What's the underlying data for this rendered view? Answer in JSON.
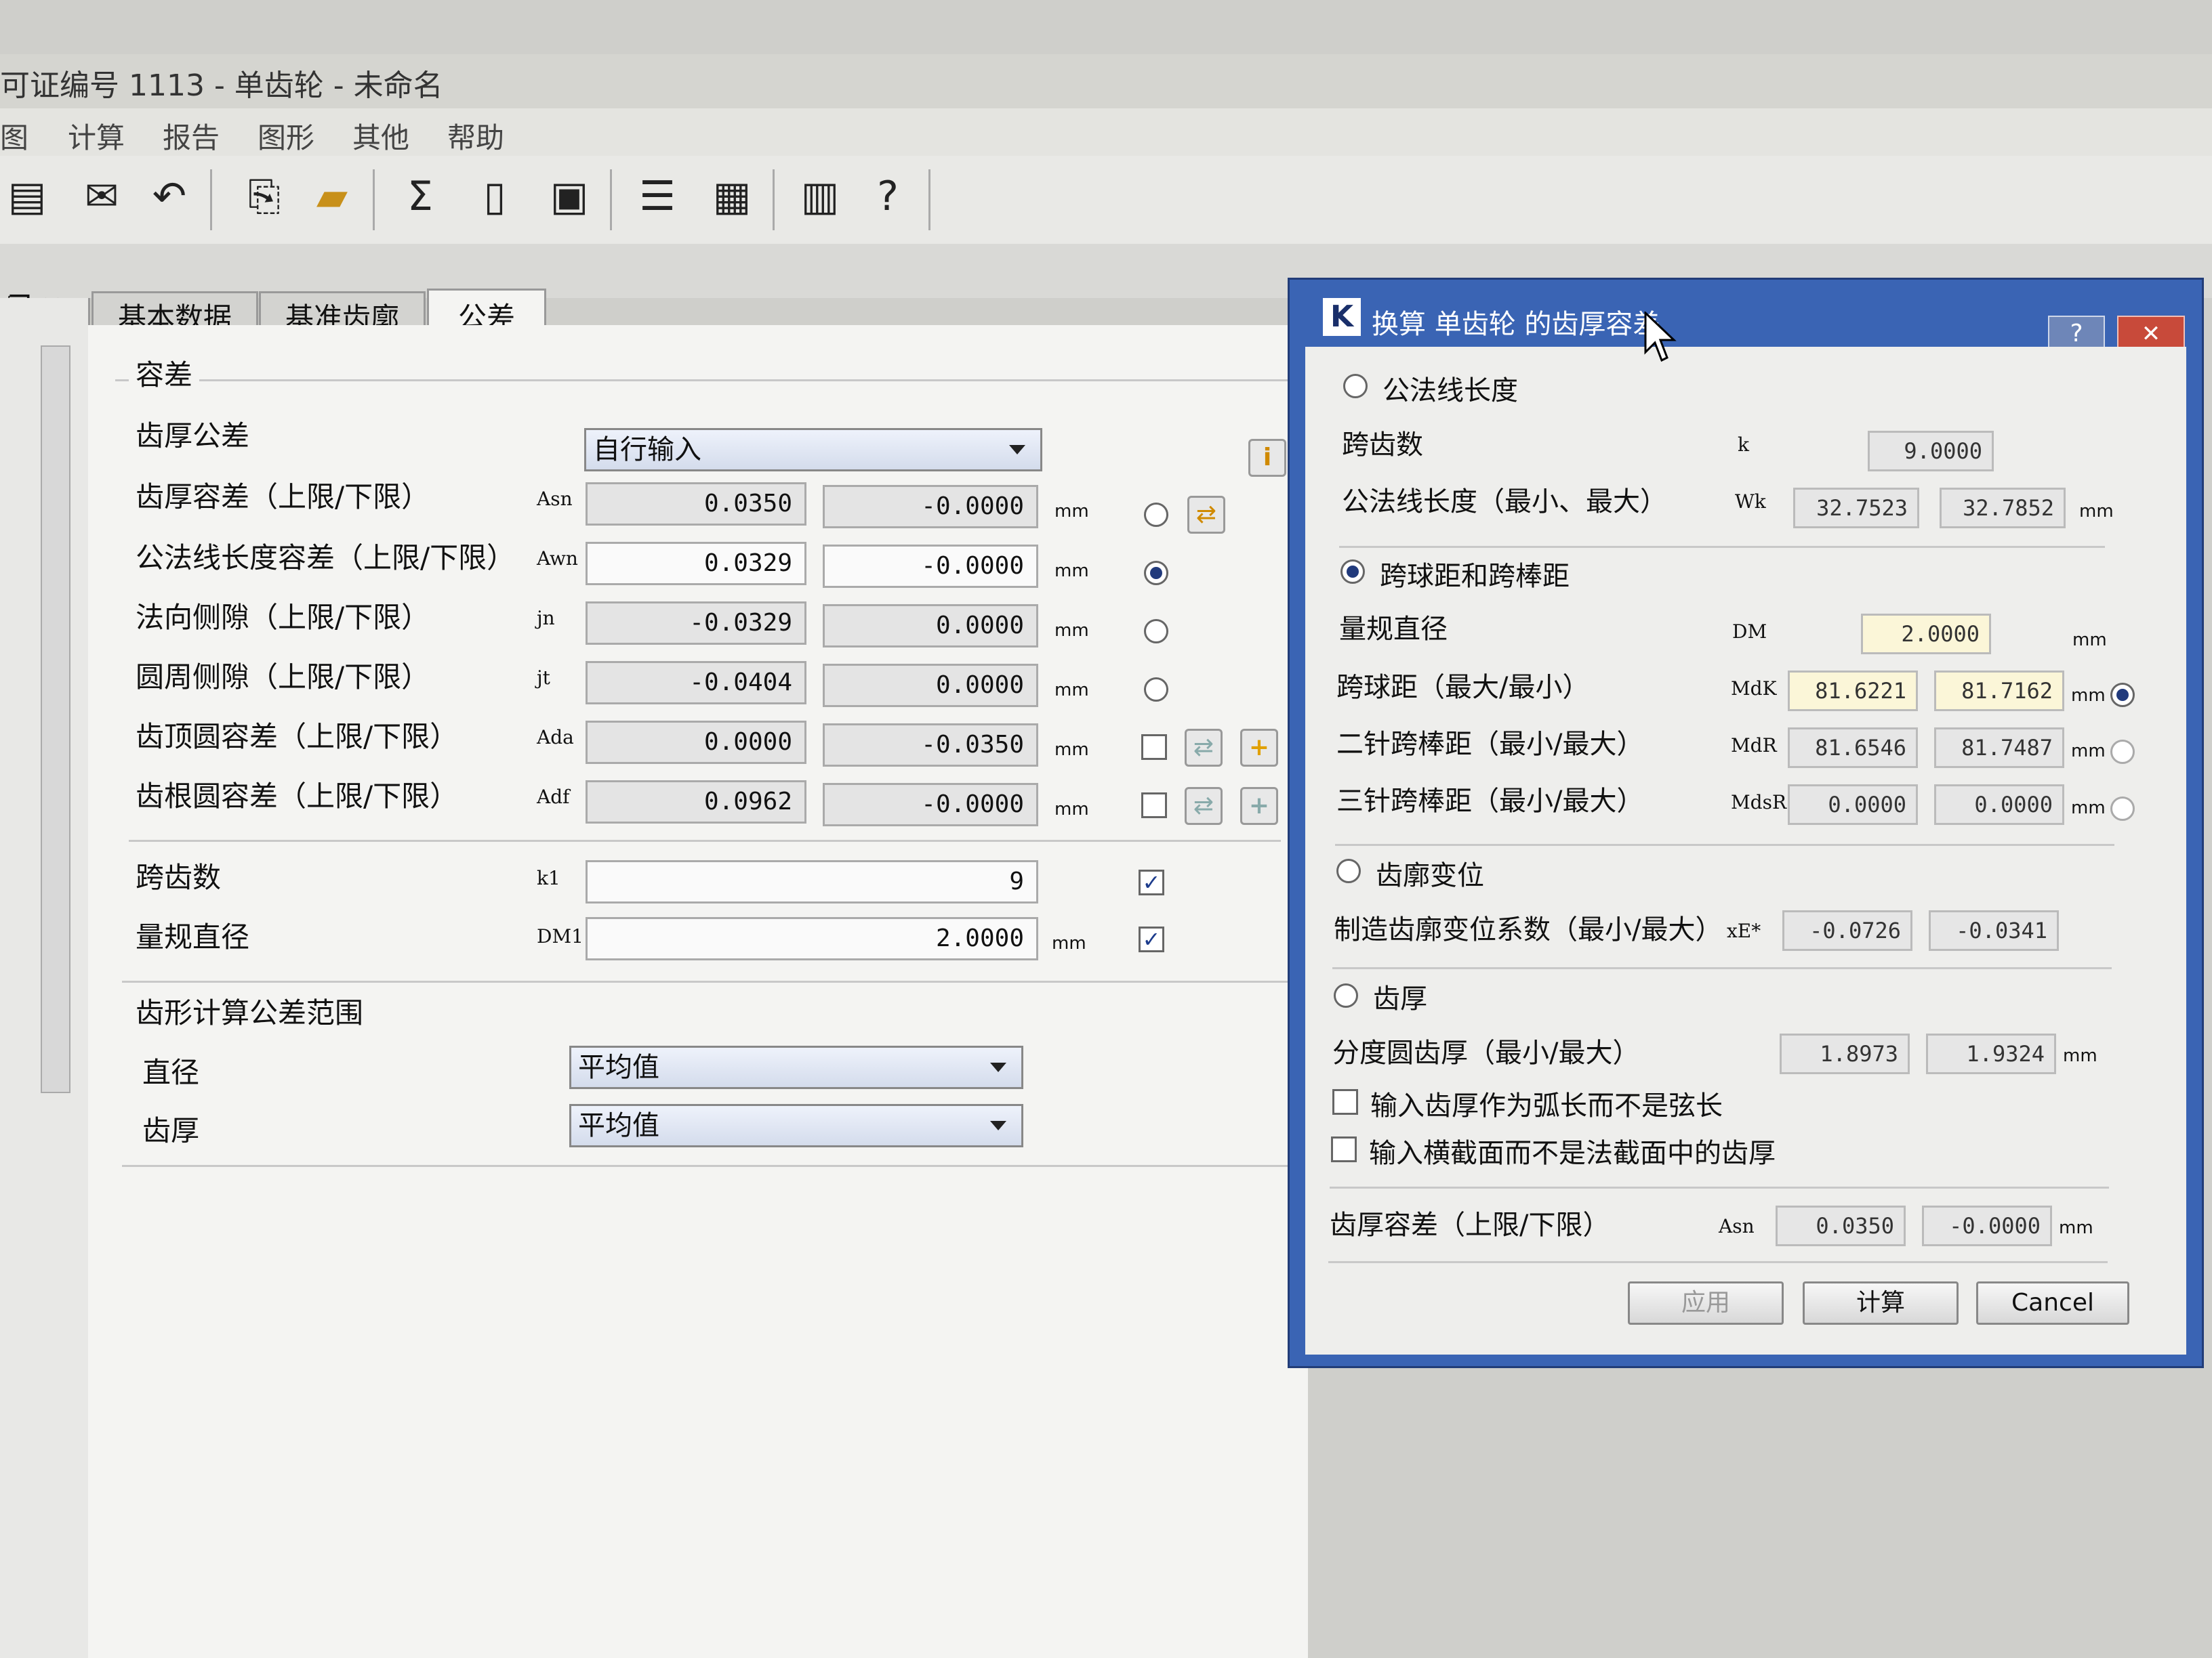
{
  "window": {
    "title": "可证编号 1113 - 单齿轮 - 未命名"
  },
  "menu": [
    "图",
    "计算",
    "报告",
    "图形",
    "其他",
    "帮助"
  ],
  "toolbar_icons": [
    "save-icon",
    "mail-icon",
    "undo-icon",
    "import-icon",
    "open-folder-icon",
    "sigma-icon",
    "document-icon",
    "print-preview-icon",
    "database-icon",
    "calculator-icon",
    "book-icon",
    "help-pointer-icon"
  ],
  "tabs": [
    "基本数据",
    "基准齿廓",
    "公差"
  ],
  "tolerance": {
    "group_title": "容差",
    "tooth_thickness_tol_label": "齿厚公差",
    "tooth_thickness_tol_value": "自行输入",
    "rows": [
      {
        "label": "齿厚容差（上限/下限）",
        "sym": "Asn",
        "v1": "0.0350",
        "v2": "-0.0000",
        "unit": "mm"
      },
      {
        "label": "公法线长度容差（上限/下限）",
        "sym": "Awn",
        "v1": "0.0329",
        "v2": "-0.0000",
        "unit": "mm"
      },
      {
        "label": "法向侧隙（上限/下限）",
        "sym": "jn",
        "v1": "-0.0329",
        "v2": "0.0000",
        "unit": "mm"
      },
      {
        "label": "圆周侧隙（上限/下限）",
        "sym": "jt",
        "v1": "-0.0404",
        "v2": "0.0000",
        "unit": "mm"
      },
      {
        "label": "齿顶圆容差（上限/下限）",
        "sym": "Ada",
        "v1": "0.0000",
        "v2": "-0.0350",
        "unit": "mm"
      },
      {
        "label": "齿根圆容差（上限/下限）",
        "sym": "Adf",
        "v1": "0.0962",
        "v2": "-0.0000",
        "unit": "mm"
      }
    ],
    "span_label": "跨齿数",
    "span_sym": "k1",
    "span_value": "9",
    "ball_label": "量规直径",
    "ball_sym": "DM1",
    "ball_value": "2.0000",
    "ball_unit": "mm"
  },
  "form_calc": {
    "group_title": "齿形计算公差范围",
    "diameter_label": "直径",
    "diameter_value": "平均值",
    "thickness_label": "齿厚",
    "thickness_value": "平均值"
  },
  "dialog": {
    "title": "换算 单齿轮 的齿厚容差",
    "help": "?",
    "close": "✕",
    "sec1": "公法线长度",
    "teeth_label": "跨齿数",
    "teeth_sym": "k",
    "teeth_value": "9.0000",
    "wk_label": "公法线长度（最小、最大）",
    "wk_sym": "Wk",
    "wk_min": "32.7523",
    "wk_max": "32.7852",
    "wk_unit": "mm",
    "sec2": "跨球距和跨棒距",
    "dm_label": "量规直径",
    "dm_sym": "DM",
    "dm_value": "2.0000",
    "dm_unit": "mm",
    "mdk_label": "跨球距（最大/最小）",
    "mdk_sym": "MdK",
    "mdk_a": "81.6221",
    "mdk_b": "81.7162",
    "mdk_unit": "mm",
    "mdr2_label": "二针跨棒距（最小/最大）",
    "mdr2_sym": "MdR",
    "mdr2_a": "81.6546",
    "mdr2_b": "81.7487",
    "mdr2_unit": "mm",
    "mdr3_label": "三针跨棒距（最小/最大）",
    "mdr3_sym": "MdsR",
    "mdr3_a": "0.0000",
    "mdr3_b": "0.0000",
    "mdr3_unit": "mm",
    "sec3": "齿廓变位",
    "xe_label": "制造齿廓变位系数（最小/最大）",
    "xe_sym": "xE*",
    "xe_a": "-0.0726",
    "xe_b": "-0.0341",
    "sec4": "齿厚",
    "s_label": "分度圆齿厚（最小/最大）",
    "s_a": "1.8973",
    "s_b": "1.9324",
    "s_unit": "mm",
    "chk1": "输入齿厚作为弧长而不是弦长",
    "chk2": "输入横截面而不是法截面中的齿厚",
    "tol_label": "齿厚容差（上限/下限）",
    "tol_sym": "Asn",
    "tol_a": "0.0350",
    "tol_b": "-0.0000",
    "tol_unit": "mm",
    "btn_apply": "应用",
    "btn_calc": "计算",
    "btn_cancel": "Cancel"
  }
}
